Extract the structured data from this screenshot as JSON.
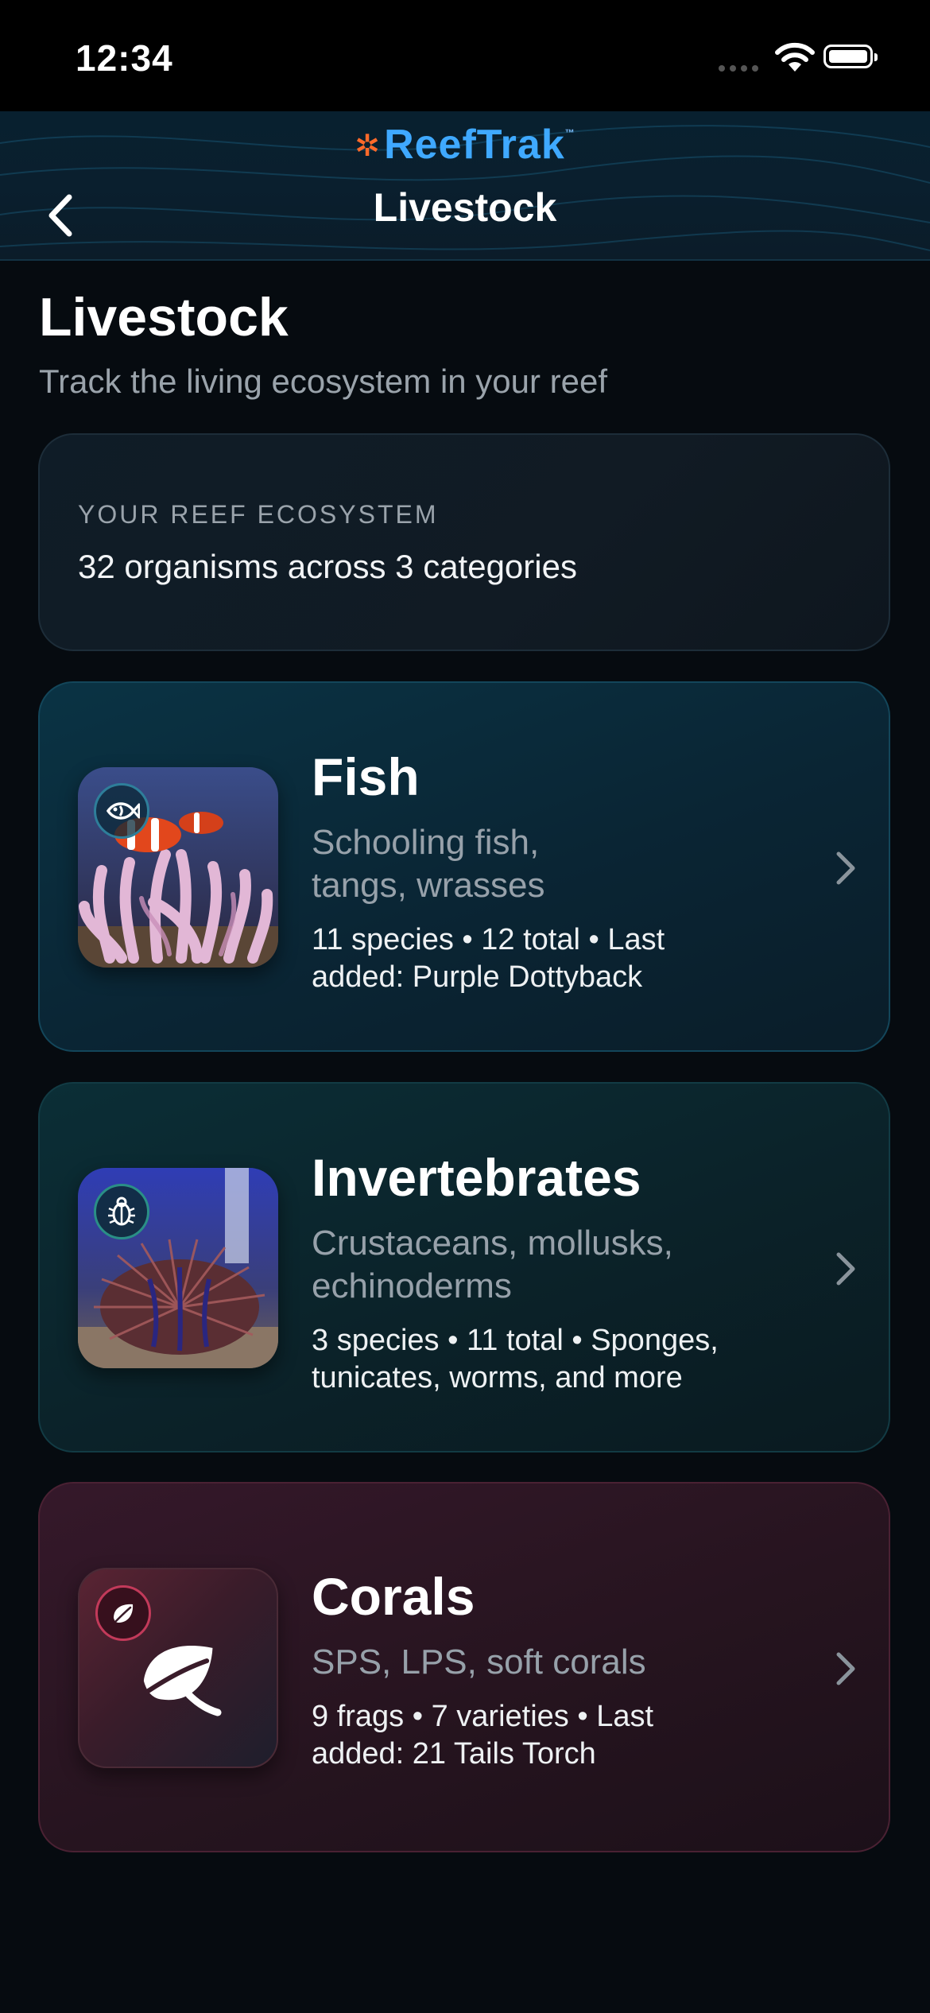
{
  "status_bar": {
    "time": "12:34"
  },
  "nav": {
    "logo": "ReefTrak",
    "logo_mark": "™",
    "title": "Livestock"
  },
  "page": {
    "title": "Livestock",
    "subtitle": "Track the living ecosystem in your reef"
  },
  "ecosystem": {
    "label": "YOUR REEF ECOSYSTEM",
    "summary": "32 organisms across 3 categories"
  },
  "categories": [
    {
      "name": "Fish",
      "desc_line1": "Schooling fish,",
      "desc_line2": "tangs, wrasses",
      "stats_line1": "11 species • 12 total • Last",
      "stats_line2": "added: Purple Dottyback",
      "icon": "fish-icon",
      "accent": "#2aa7c9"
    },
    {
      "name": "Invertebrates",
      "desc_line1": "Crustaceans, mollusks,",
      "desc_line2": "echinoderms",
      "stats_line1": "3 species • 11 total • Sponges,",
      "stats_line2": "tunicates, worms, and more",
      "icon": "bug-icon",
      "accent": "#2ab3a3"
    },
    {
      "name": "Corals",
      "desc_line1": "SPS, LPS, soft corals",
      "stats_line1": "9 frags • 7 varieties • Last",
      "stats_line2": "added: 21 Tails Torch",
      "icon": "leaf-icon",
      "accent": "#c23a5a"
    }
  ]
}
